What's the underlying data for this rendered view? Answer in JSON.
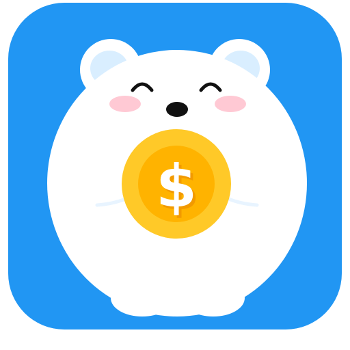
{
  "icon": {
    "background_color": "#2196F3",
    "subject": "polar-bear-icon",
    "coin": {
      "symbol": "$",
      "outer_color": "#FFC928",
      "inner_color": "#FFB300",
      "symbol_color": "#FFFFFF",
      "symbol_shadow_color": "#F29A00"
    },
    "bear": {
      "body_color": "#FFFFFF",
      "inner_ear_color": "#D9EEFF",
      "cheek_color": "#FFC9D4",
      "eye_color": "#111111",
      "nose_color": "#111111"
    }
  }
}
